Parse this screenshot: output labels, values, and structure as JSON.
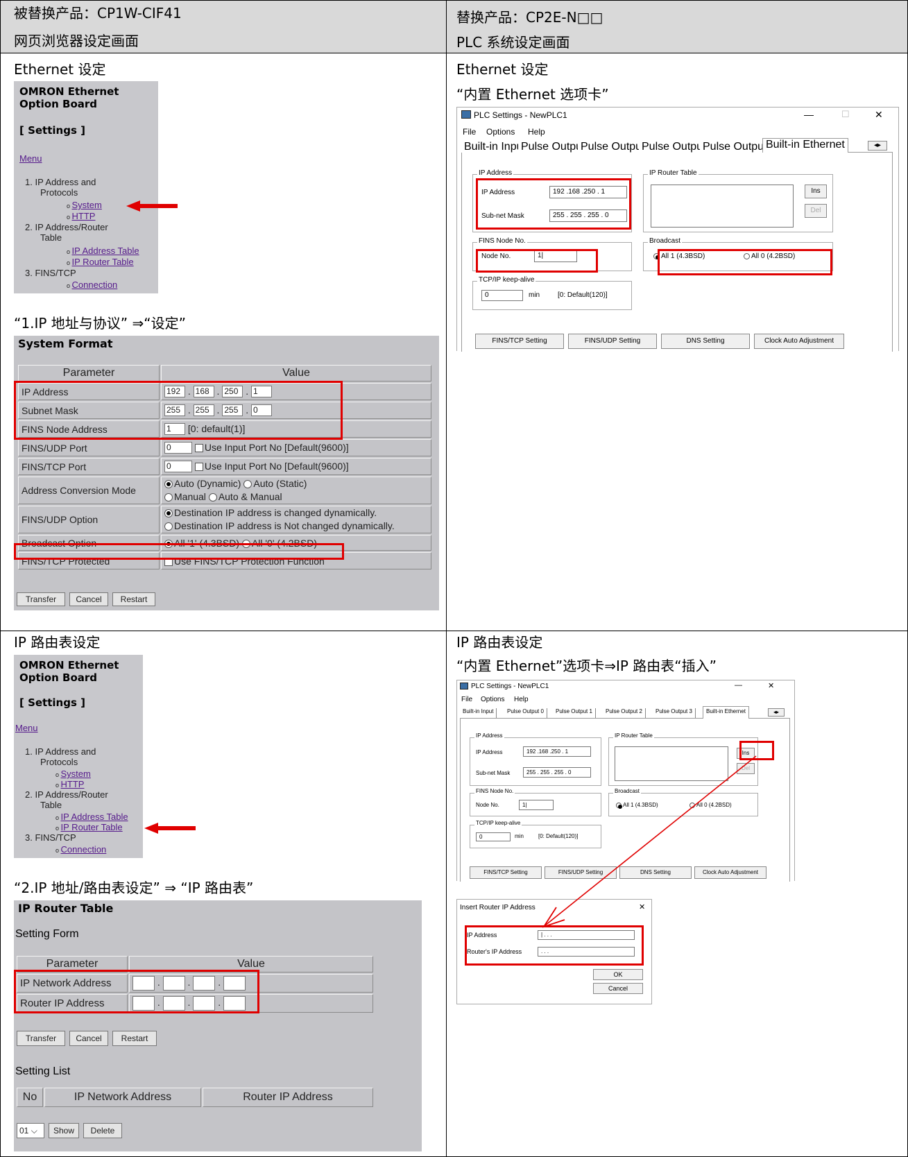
{
  "header": {
    "left_title": "被替换产品：CP1W-CIF41",
    "left_subtitle": "网页浏览器设定画面",
    "right_title": "替换产品：CP2E-N□□",
    "right_subtitle": "PLC 系统设定画面"
  },
  "section1": {
    "left_heading": "Ethernet 设定",
    "right_heading": "Ethernet 设定",
    "right_caption": "“内置 Ethernet 选项卡”",
    "left_caption": "“1.IP 地址与协议” ⇒“设定”"
  },
  "section2": {
    "left_heading": "IP 路由表设定",
    "right_heading": "IP 路由表设定",
    "right_caption": "“内置 Ethernet”选项卡⇒IP 路由表“插入”",
    "left_caption": "“2.IP 地址/路由表设定” ⇒ “IP 路由表”"
  },
  "web_menu": {
    "brand_line1": "OMRON Ethernet",
    "brand_line2": "Option Board",
    "settings": "[ Settings ]",
    "menu": "Menu",
    "item1": "1.  IP Address and",
    "item1b": "Protocols",
    "system": "System",
    "http": "HTTP",
    "item2": "2.  IP Address/Router",
    "item2b": "Table",
    "ip_address_table": "IP Address Table",
    "ip_router_table": "IP Router Table",
    "item3": "3.  FINS/TCP",
    "connection": "Connection"
  },
  "system_format": {
    "title": "System Format",
    "col_param": "Parameter",
    "col_value": "Value",
    "ip_label": "IP Address",
    "ip": [
      "192",
      "168",
      "250",
      "1"
    ],
    "subnet_label": "Subnet Mask",
    "subnet": [
      "255",
      "255",
      "255",
      "0"
    ],
    "node_label": "FINS Node Address",
    "node_val": "1",
    "node_hint": "[0: default(1)]",
    "udp_port_label": "FINS/UDP Port",
    "udp_port_val": "0",
    "udp_port_opt": "Use Input Port No [Default(9600)]",
    "tcp_port_label": "FINS/TCP Port",
    "tcp_port_val": "0",
    "tcp_port_opt": "Use Input Port No [Default(9600)]",
    "conv_label": "Address Conversion Mode",
    "conv_opt1": "Auto (Dynamic)",
    "conv_opt2": "Auto (Static)",
    "conv_opt3": "Manual",
    "conv_opt4": "Auto & Manual",
    "udp_opt_label": "FINS/UDP Option",
    "udp_opt1": "Destination IP address is changed dynamically.",
    "udp_opt2": "Destination IP address is Not changed dynamically.",
    "bcast_label": "Broadcast Option",
    "bcast_opt1": "All '1' (4.3BSD)",
    "bcast_opt2": "All '0' (4.2BSD)",
    "tcp_prot_label": "FINS/TCP Protected",
    "tcp_prot_opt": "Use FINS/TCP Protection Function",
    "btn_transfer": "Transfer",
    "btn_cancel": "Cancel",
    "btn_restart": "Restart"
  },
  "router_table": {
    "title": "IP Router Table",
    "setting_form": "Setting Form",
    "col_param": "Parameter",
    "col_value": "Value",
    "net_label": "IP Network Address",
    "router_label": "Router IP Address",
    "btn_transfer": "Transfer",
    "btn_cancel": "Cancel",
    "btn_restart": "Restart",
    "setting_list": "Setting List",
    "list_no": "No",
    "list_net": "IP Network Address",
    "list_router": "Router IP Address",
    "select_val": "01",
    "btn_show": "Show",
    "btn_delete": "Delete"
  },
  "plc_window": {
    "title": "PLC Settings - NewPLC1",
    "menu_file": "File",
    "menu_options": "Options",
    "menu_help": "Help",
    "tab_input": "Built-in Input",
    "tab_p0": "Pulse Output 0",
    "tab_p1": "Pulse Output 1",
    "tab_p2": "Pulse Output 2",
    "tab_p3": "Pulse Output 3",
    "tab_eth": "Built-in Ethernet",
    "grp_ip": "IP Address",
    "ip_label": "IP Address",
    "ip_val": "192 .168 .250 .  1",
    "subnet_label": "Sub-net Mask",
    "subnet_val": "255 . 255 . 255 .  0",
    "grp_router": "IP Router Table",
    "btn_ins": "Ins",
    "btn_del": "Del",
    "grp_fins": "FINS Node No.",
    "node_label": "Node No.",
    "node_val": "1|",
    "grp_bcast": "Broadcast",
    "bcast1": "All 1 (4.3BSD)",
    "bcast0": "All 0 (4.2BSD)",
    "grp_keep": "TCP/IP keep-alive",
    "keep_val": "0",
    "keep_unit": "min",
    "keep_hint": "[0: Default(120)]",
    "btn_fins_tcp": "FINS/TCP Setting",
    "btn_fins_udp": "FINS/UDP Setting",
    "btn_dns": "DNS Setting",
    "btn_clock": "Clock Auto Adjustment",
    "btn_min": "—",
    "btn_max": "☐",
    "btn_close": "✕"
  },
  "dialog": {
    "title": "Insert Router IP Address",
    "ip_label": "IP Address",
    "router_label": "Router's IP Address",
    "ip_val": "|  .     .     .",
    "router_val": "   .     .     .",
    "btn_ok": "OK",
    "btn_cancel": "Cancel",
    "btn_close": "✕"
  },
  "colors": {
    "highlight": "#e00000",
    "header_bg": "#d9d9d9",
    "web_panel": "#c8c8cc"
  }
}
